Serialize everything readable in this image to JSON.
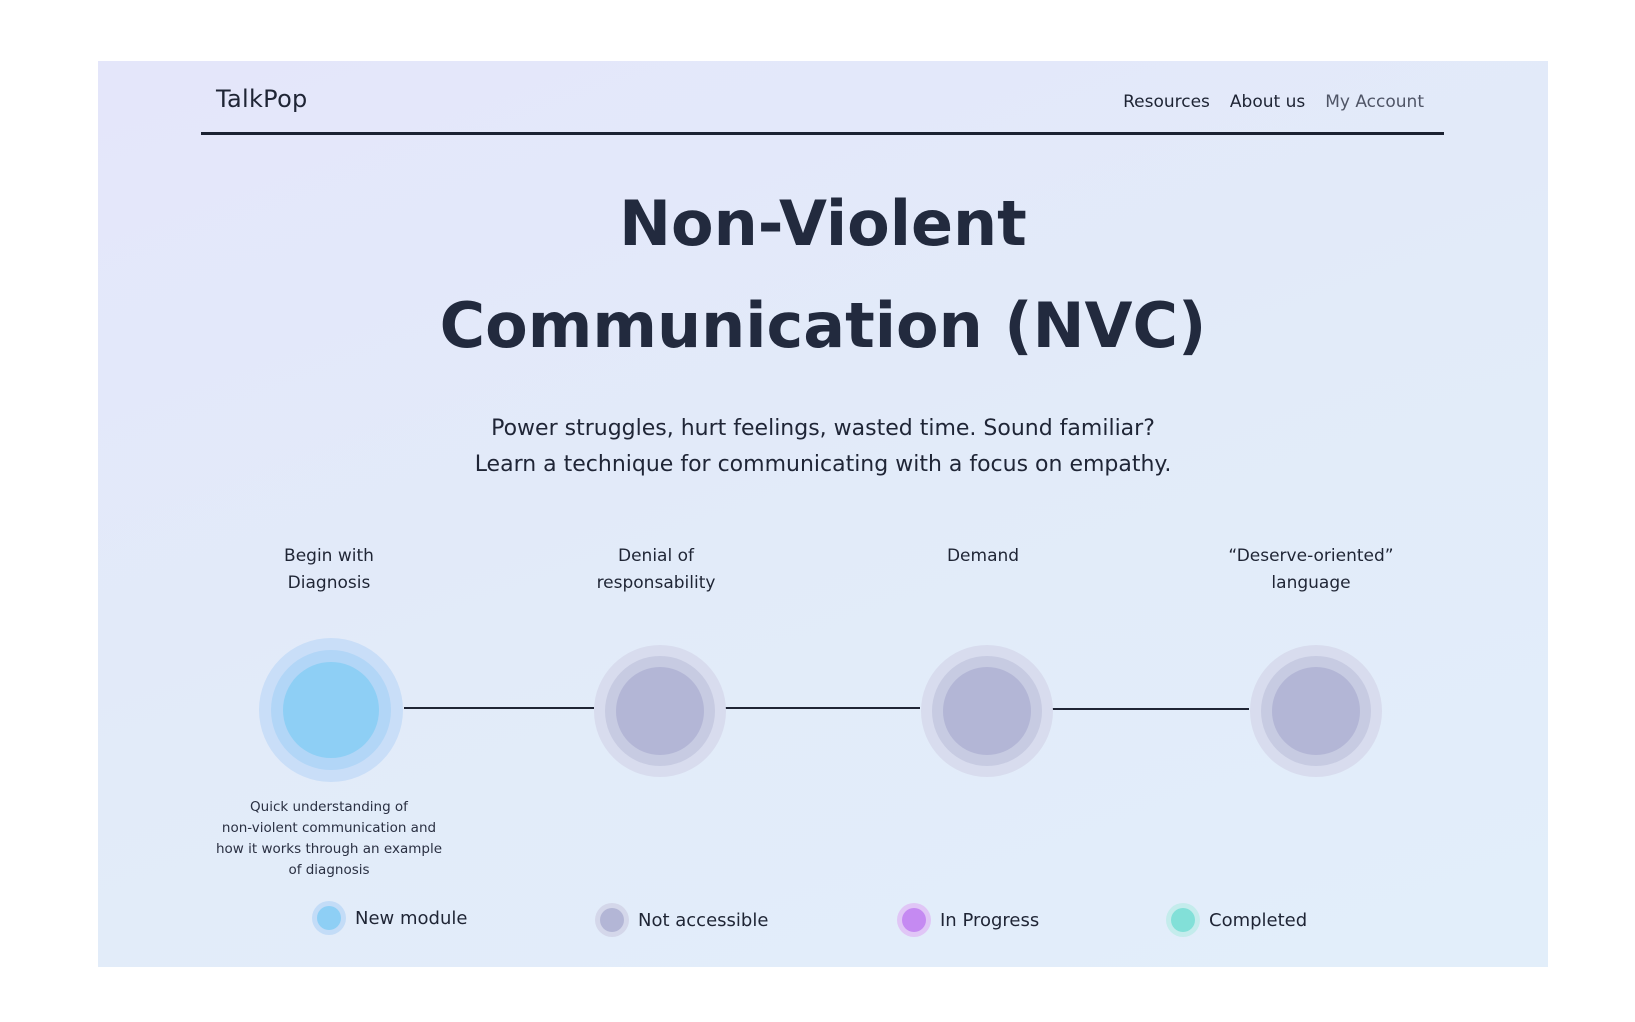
{
  "nav": {
    "brand": "TalkPop",
    "links": [
      {
        "label": "Resources"
      },
      {
        "label": "About us"
      },
      {
        "label": "My Account"
      }
    ]
  },
  "hero": {
    "title_line1": "Non-Violent",
    "title_line2": "Communication (NVC)",
    "subtitle_line1": "Power struggles, hurt feelings, wasted time. Sound familiar?",
    "subtitle_line2": "Learn a technique for communicating with a focus on empathy."
  },
  "steps": [
    {
      "label_line1": "Begin with",
      "label_line2": "Diagnosis",
      "status": "new"
    },
    {
      "label_line1": "Denial of",
      "label_line2": "responsability",
      "status": "not_accessible"
    },
    {
      "label_line1": "Demand",
      "label_line2": "",
      "status": "not_accessible"
    },
    {
      "label_line1": "“Deserve-oriented”",
      "label_line2": "language",
      "status": "not_accessible"
    }
  ],
  "step_description": {
    "lines": [
      "Quick understanding of",
      "non-violent communication and",
      "how it works through an example",
      "of diagnosis"
    ]
  },
  "legend": [
    {
      "label": "New module",
      "color": "#8ecff5",
      "halo": "#c3dcf7"
    },
    {
      "label": "Not accessible",
      "color": "#b3b6d6",
      "halo": "#d4d7ea"
    },
    {
      "label": "In Progress",
      "color": "#c58af2",
      "halo": "#e0c6f6"
    },
    {
      "label": "Completed",
      "color": "#82e0d8",
      "halo": "#c4ecec"
    }
  ]
}
